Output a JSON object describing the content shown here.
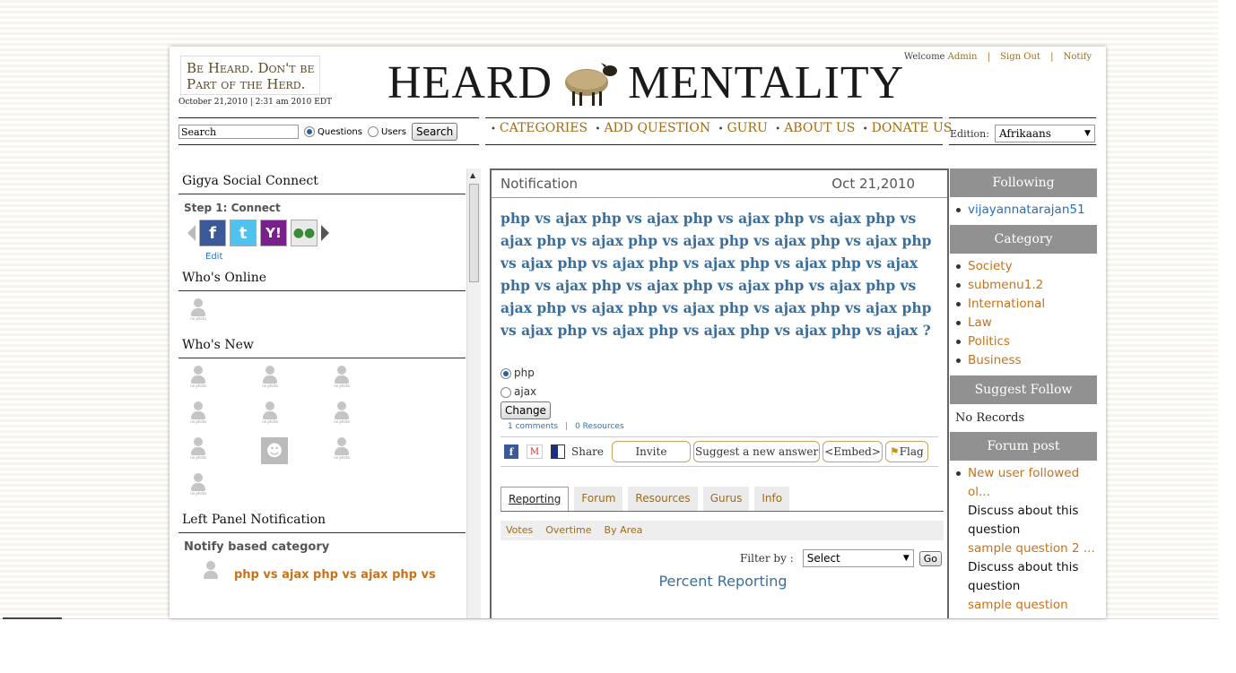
{
  "header": {
    "tagline_line1": "Be Heard. Don't be",
    "tagline_line2": "Part of the Herd.",
    "datetime": "October 21,2010 | 2:31 am 2010 EDT",
    "logo_left": "HEARD",
    "logo_right": "MENTALITY",
    "welcome": "Welcome",
    "username": "Admin",
    "sign_out": "Sign Out",
    "notify": "Notify"
  },
  "search": {
    "value": "Search",
    "opt_questions": "Questions",
    "opt_users": "Users",
    "button": "Search"
  },
  "nav": [
    "CATEGORIES",
    "ADD QUESTION",
    "GURU",
    "ABOUT US",
    "DONATE US"
  ],
  "edition": {
    "label": "Edition:",
    "value": "Afrikaans"
  },
  "left": {
    "gigya_title": "Gigya Social Connect",
    "step_bold": "Step 1:",
    "step_text": " Connect",
    "edit": "Edit",
    "online_title": "Who's Online",
    "new_title": "Who's New",
    "avatar_caption": "no photo",
    "notif_title": "Left Panel Notification",
    "notify_cat": "Notify based category",
    "notify_q": "php vs ajax php vs ajax php vs"
  },
  "center": {
    "title": "Notification",
    "date": "Oct 21,2010",
    "question": "php vs ajax php vs ajax php vs ajax php vs ajax php vs ajax php vs ajax php vs ajax php vs ajax php vs ajax php vs ajax php vs ajax php vs ajax php vs ajax php vs ajax php vs ajax php vs ajax php vs ajax php vs ajax php vs ajax php vs ajax php vs ajax php vs ajax php vs ajax php vs ajax php vs ajax php vs ajax php vs ajax php vs ajax ?",
    "option1": "php",
    "option2": "ajax",
    "change_button": "Change",
    "comments": "1 comments",
    "resources": "0 Resources",
    "share": "Share",
    "invite": "Invite",
    "suggest": "Suggest a new answer",
    "embed": "<Embed>",
    "flag": "Flag",
    "tabs": [
      "Reporting",
      "Forum",
      "Resources",
      "Gurus",
      "Info"
    ],
    "subtabs": [
      "Votes",
      "Overtime",
      "By Area"
    ],
    "filter_label": "Filter by :",
    "filter_value": "Select",
    "go": "Go",
    "percent_title": "Percent Reporting"
  },
  "right": {
    "following_title": "Following",
    "following": [
      "vijayannatarajan51"
    ],
    "category_title": "Category",
    "categories": [
      "Society",
      "submenu1.2",
      "International",
      "Law",
      "Politics",
      "Business"
    ],
    "suggest_title": "Suggest Follow",
    "no_records": "No Records",
    "forum_title": "Forum post",
    "forum_link1a": "New user followed",
    "forum_link1b": "ol...",
    "forum_text1a": "Discuss about this",
    "forum_text1b": "question",
    "forum_link2": "sample question 2 ...",
    "forum_text2a": "Discuss about this",
    "forum_text2b": "question",
    "forum_link3": "sample question"
  }
}
